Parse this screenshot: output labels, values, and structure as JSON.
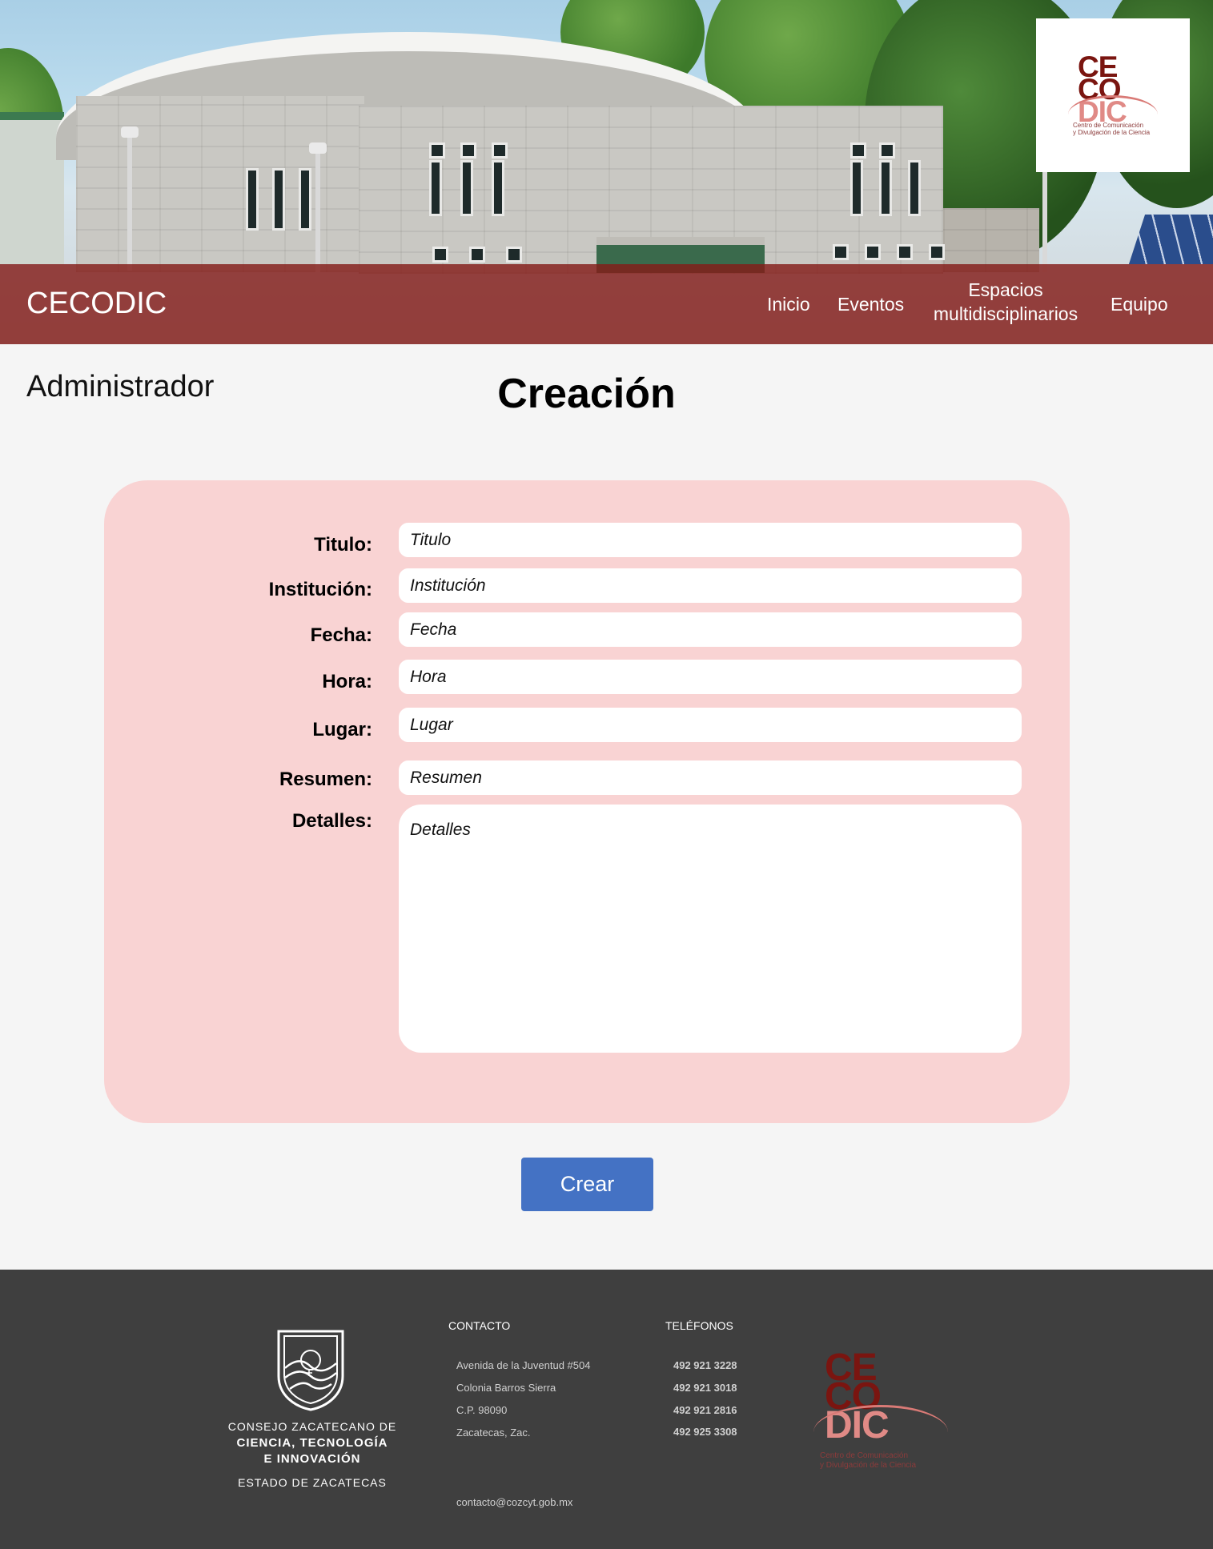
{
  "header": {
    "logo": {
      "line1": "CE",
      "line2": "CO",
      "line3": "DIC",
      "sub1": "Centro de Comunicación",
      "sub2": "y Divulgación de la Ciencia"
    },
    "brand": "CECODIC",
    "nav": [
      {
        "label": "Inicio"
      },
      {
        "label": "Eventos"
      },
      {
        "label_line1": "Espacios",
        "label_line2": "multidisciplinarios"
      },
      {
        "label": "Equipo"
      }
    ]
  },
  "main": {
    "admin_label": "Administrador",
    "title": "Creación",
    "form": {
      "fields": [
        {
          "label": "Titulo:",
          "placeholder": "Titulo"
        },
        {
          "label": "Institución:",
          "placeholder": "Institución"
        },
        {
          "label": "Fecha:",
          "placeholder": "Fecha"
        },
        {
          "label": "Hora:",
          "placeholder": "Hora"
        },
        {
          "label": "Lugar:",
          "placeholder": "Lugar"
        },
        {
          "label": "Resumen:",
          "placeholder": "Resumen"
        }
      ],
      "details": {
        "label": "Detalles:",
        "placeholder": "Detalles"
      }
    },
    "submit_label": "Crear"
  },
  "footer": {
    "org": {
      "line1": "CONSEJO ZACATECANO DE",
      "line2": "CIENCIA, TECNOLOGÍA",
      "line3": "E INNOVACIÓN",
      "line4": "ESTADO DE ZACATECAS"
    },
    "contact": {
      "heading": "CONTACTO",
      "address": [
        "Avenida de la Juventud #504",
        "Colonia Barros Sierra",
        "C.P. 98090",
        "Zacatecas, Zac."
      ],
      "email": "contacto@cozcyt.gob.mx"
    },
    "phones": {
      "heading": "TELÉFONOS",
      "numbers": [
        "492 921 3228",
        "492 921 3018",
        "492 921 2816",
        "492 925 3308"
      ]
    },
    "logo": {
      "line1": "CE",
      "line2": "CO",
      "line3": "DIC",
      "sub1": "Centro de Comunicación",
      "sub2": "y Divulgación de la Ciencia"
    }
  },
  "colors": {
    "navbar": "#841c18",
    "form_card": "#f9d3d3",
    "button": "#4472c4",
    "footer": "#3f3f3f",
    "logo_dark": "#7a1510",
    "logo_light": "#e08a86"
  }
}
